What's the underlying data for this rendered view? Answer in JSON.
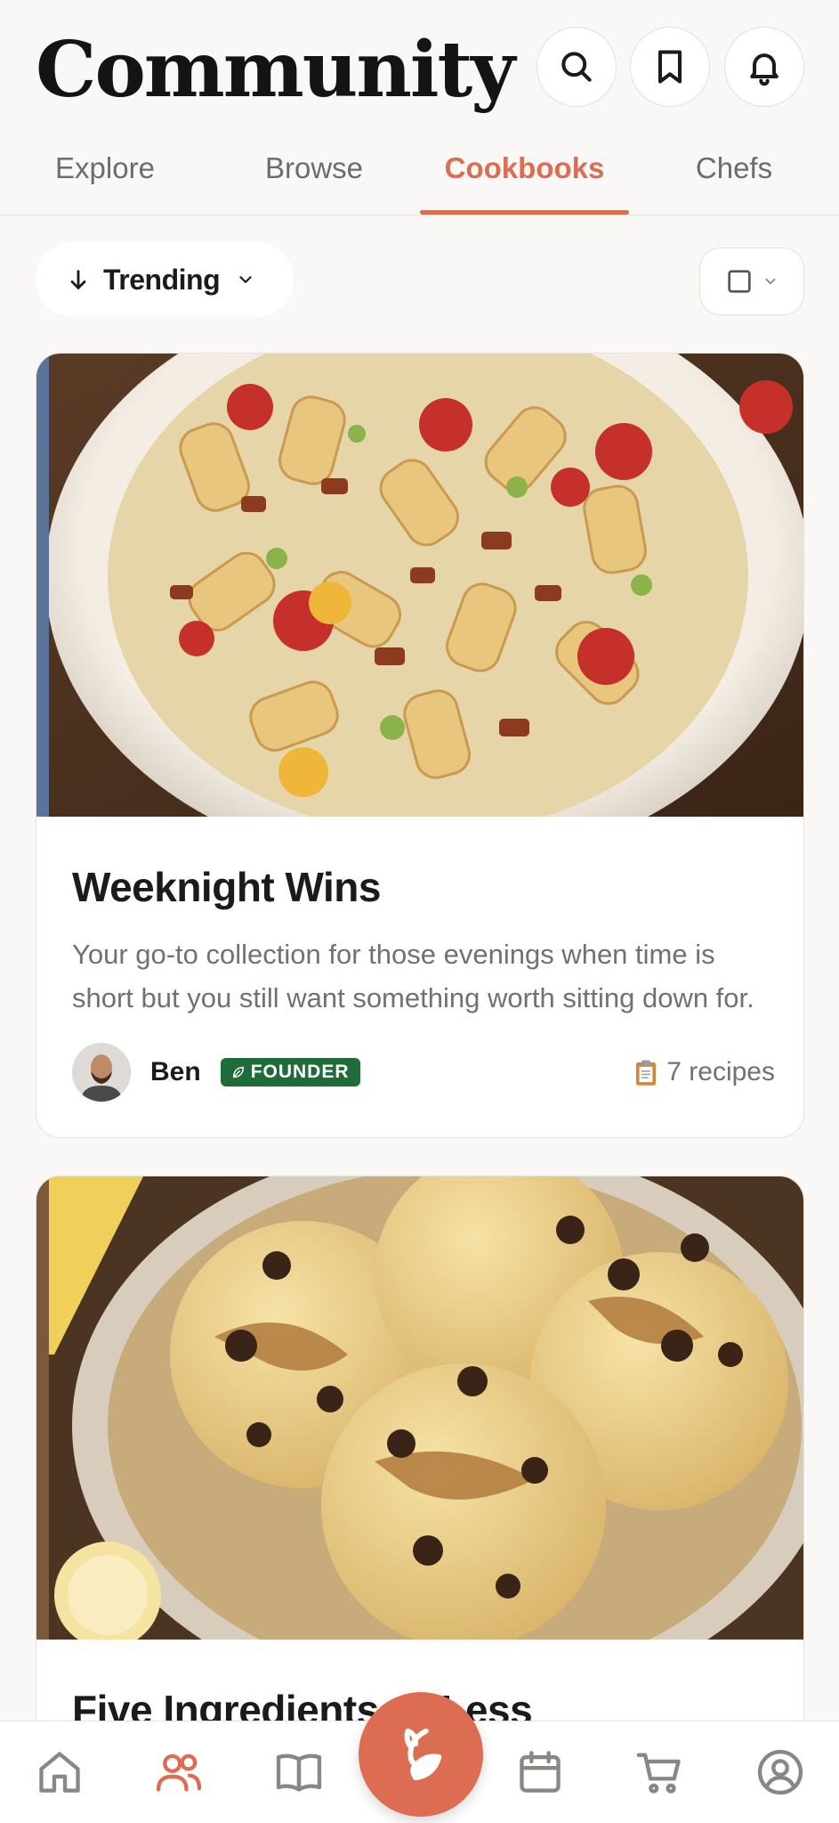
{
  "header": {
    "title": "Community",
    "actions": [
      {
        "icon": "search-icon"
      },
      {
        "icon": "bookmark-icon"
      },
      {
        "icon": "bell-icon"
      }
    ]
  },
  "tabs": [
    {
      "label": "Explore",
      "active": false
    },
    {
      "label": "Browse",
      "active": false
    },
    {
      "label": "Cookbooks",
      "active": true
    },
    {
      "label": "Chefs",
      "active": false
    }
  ],
  "filters": {
    "sort_label": "Trending",
    "sort_icon": "arrow-down-icon",
    "view_icon": "square-icon"
  },
  "cookbooks": [
    {
      "title": "Weeknight Wins",
      "description": "Your go-to collection for those evenings when time is short but you still want something worth sitting down for.",
      "author": "Ben",
      "badge": "FOUNDER",
      "recipe_count": "7 recipes",
      "accent_color": "#5a7499",
      "image": "pasta-salad-photo"
    },
    {
      "title": "Five Ingredients or Less",
      "accent_color": "#7b5a3c",
      "image": "ice-cream-bowl-photo"
    }
  ],
  "bottom_nav": [
    {
      "icon": "home-icon",
      "active": false
    },
    {
      "icon": "community-icon",
      "active": true
    },
    {
      "icon": "book-icon",
      "active": false
    },
    {
      "icon": "leaf-icon",
      "active": false
    },
    {
      "icon": "calendar-icon",
      "active": false
    },
    {
      "icon": "cart-icon",
      "active": false
    },
    {
      "icon": "profile-icon",
      "active": false
    }
  ],
  "colors": {
    "accent": "#dc6c52",
    "badge": "#1f6b3a",
    "background": "#f9f8f6"
  }
}
